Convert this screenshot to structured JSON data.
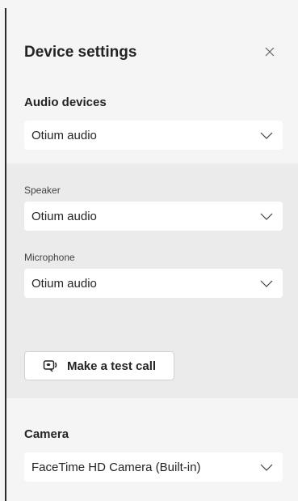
{
  "panel": {
    "title": "Device settings",
    "close_icon": "close-icon"
  },
  "audio": {
    "heading": "Audio devices",
    "selected": "Otium audio"
  },
  "speaker": {
    "label": "Speaker",
    "selected": "Otium audio"
  },
  "microphone": {
    "label": "Microphone",
    "selected": "Otium audio"
  },
  "test_call": {
    "label": "Make a test call",
    "icon": "test-call-icon"
  },
  "camera": {
    "heading": "Camera",
    "selected": "FaceTime HD Camera (Built-in)"
  }
}
